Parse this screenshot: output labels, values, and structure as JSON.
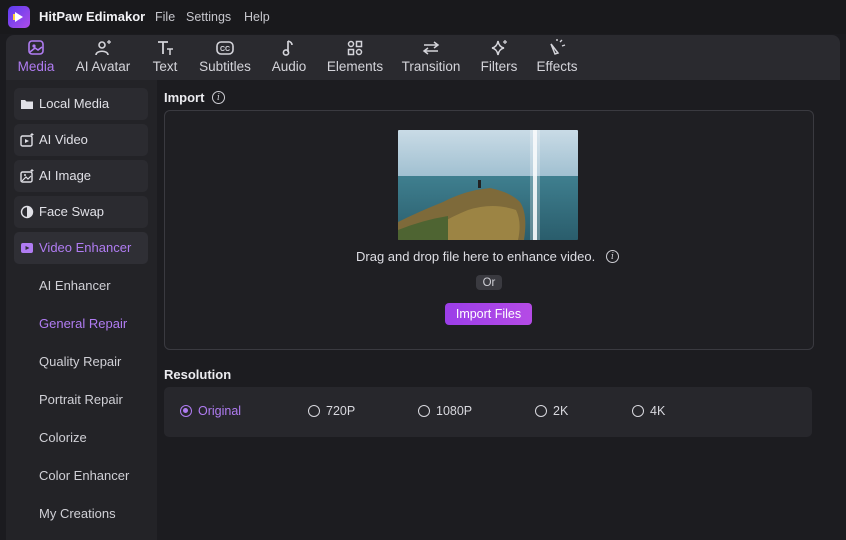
{
  "app": {
    "title": "HitPaw Edimakor",
    "menus": [
      "File",
      "Settings",
      "Help"
    ]
  },
  "toolbar": {
    "tabs": [
      {
        "label": "Media",
        "icon": "media-icon",
        "active": true
      },
      {
        "label": "AI Avatar",
        "icon": "avatar-icon",
        "active": false
      },
      {
        "label": "Text",
        "icon": "text-icon",
        "active": false
      },
      {
        "label": "Subtitles",
        "icon": "subtitles-icon",
        "active": false
      },
      {
        "label": "Audio",
        "icon": "music-note-icon",
        "active": false
      },
      {
        "label": "Elements",
        "icon": "elements-icon",
        "active": false
      },
      {
        "label": "Transition",
        "icon": "transition-arrows-icon",
        "active": false
      },
      {
        "label": "Filters",
        "icon": "sparkle-icon",
        "active": false
      },
      {
        "label": "Effects",
        "icon": "effects-icon",
        "active": false
      }
    ]
  },
  "sidebar": {
    "items": [
      {
        "label": "Local Media",
        "icon": "folder-icon"
      },
      {
        "label": "AI Video",
        "icon": "ai-video-icon"
      },
      {
        "label": "AI Image",
        "icon": "ai-image-icon"
      },
      {
        "label": "Face Swap",
        "icon": "face-swap-icon"
      },
      {
        "label": "Video Enhancer",
        "icon": "video-enhancer-icon",
        "active": true
      }
    ],
    "subitems": [
      {
        "label": "AI Enhancer"
      },
      {
        "label": "General Repair",
        "active": true
      },
      {
        "label": "Quality Repair"
      },
      {
        "label": "Portrait Repair"
      },
      {
        "label": "Colorize"
      },
      {
        "label": "Color Enhancer"
      },
      {
        "label": "My Creations"
      }
    ]
  },
  "import": {
    "title": "Import",
    "drop_text": "Drag and drop file here to enhance video.",
    "or_label": "Or",
    "button_label": "Import Files"
  },
  "resolution": {
    "title": "Resolution",
    "options": [
      {
        "label": "Original",
        "selected": true
      },
      {
        "label": "720P",
        "selected": false
      },
      {
        "label": "1080P",
        "selected": false
      },
      {
        "label": "2K",
        "selected": false
      },
      {
        "label": "4K",
        "selected": false
      }
    ]
  },
  "colors": {
    "accent": "#b07cf2",
    "button_gradient_start": "#9b3ee8",
    "button_gradient_end": "#b54be6",
    "background": "#1b1b1f"
  }
}
